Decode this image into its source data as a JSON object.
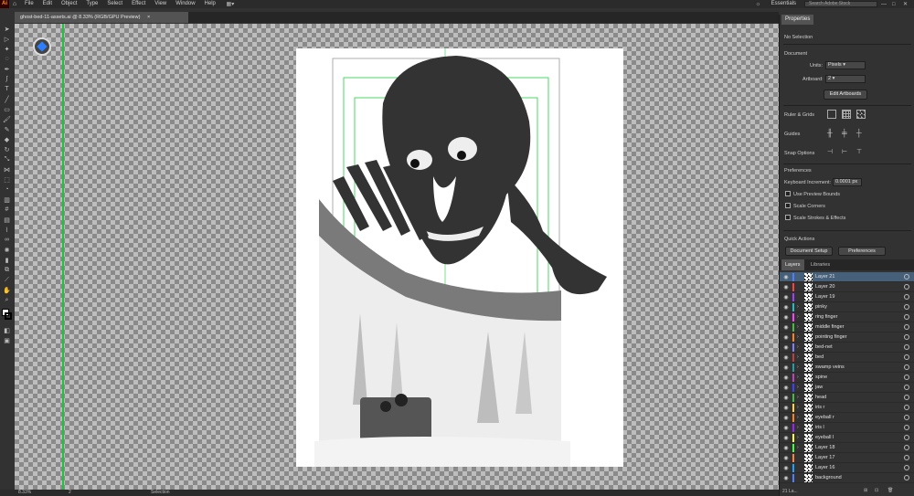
{
  "app": {
    "logo": "Ai",
    "workspace": "Essentials",
    "search_placeholder": "Search Adobe Stock"
  },
  "menu": [
    "File",
    "Edit",
    "Object",
    "Type",
    "Select",
    "Effect",
    "View",
    "Window",
    "Help"
  ],
  "document": {
    "tab_title": "ghost-bed-11-assets.ai @ 8.33% (RGB/GPU Preview)",
    "close": "×"
  },
  "properties": {
    "tab": "Properties",
    "selection": "No Selection",
    "document_heading": "Document",
    "units_label": "Units:",
    "units_value": "Pixels",
    "artboard_label": "Artboard:",
    "artboard_value": "2",
    "edit_artboards": "Edit Artboards",
    "ruler_grids": "Ruler & Grids",
    "guides": "Guides",
    "snap_options": "Snap Options",
    "preferences_heading": "Preferences",
    "keyboard_increment_label": "Keyboard Increment:",
    "keyboard_increment_value": "0.0001 px",
    "use_preview_bounds": "Use Preview Bounds",
    "scale_corners": "Scale Corners",
    "scale_strokes": "Scale Strokes & Effects",
    "quick_actions": "Quick Actions",
    "document_setup": "Document Setup",
    "preferences_button": "Preferences"
  },
  "layers_panel": {
    "tabs": [
      "Layers",
      "Libraries"
    ],
    "footer_count": "21 La...",
    "layers": [
      {
        "name": "Layer 21",
        "color": "#4f7fff"
      },
      {
        "name": "Layer 20",
        "color": "#ff4040"
      },
      {
        "name": "Layer 19",
        "color": "#a040ff"
      },
      {
        "name": "pinky",
        "color": "#20c0c0"
      },
      {
        "name": "ring finger",
        "color": "#ff40ff"
      },
      {
        "name": "middle finger",
        "color": "#40c040"
      },
      {
        "name": "pointing finger",
        "color": "#ff8020"
      },
      {
        "name": "bed-net",
        "color": "#8080ff"
      },
      {
        "name": "bed",
        "color": "#c04040"
      },
      {
        "name": "swamp veins",
        "color": "#20a0a0"
      },
      {
        "name": "spine",
        "color": "#c040c0"
      },
      {
        "name": "jaw",
        "color": "#4040ff"
      },
      {
        "name": "head",
        "color": "#40c040"
      },
      {
        "name": "iris r",
        "color": "#ffd040"
      },
      {
        "name": "eyeball r",
        "color": "#ff8020"
      },
      {
        "name": "iris l",
        "color": "#a020ff"
      },
      {
        "name": "eyeball l",
        "color": "#ffff40"
      },
      {
        "name": "Layer 18",
        "color": "#40ff40"
      },
      {
        "name": "Layer 17",
        "color": "#ff8040"
      },
      {
        "name": "Layer 16",
        "color": "#20a0ff"
      },
      {
        "name": "background",
        "color": "#4f7fff"
      }
    ]
  },
  "status": {
    "zoom": "8.33%",
    "artboard": "2",
    "tool": "Selection"
  }
}
